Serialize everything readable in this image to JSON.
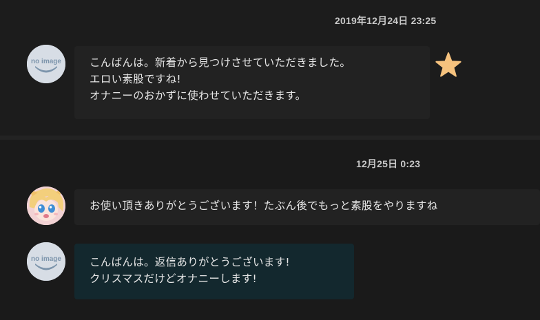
{
  "messages": [
    {
      "timestamp": "2019年12月24日 23:25",
      "avatar": "no-image-avatar",
      "lines": [
        "こんばんは。新着から見つけさせていただきました。",
        "エロい素股ですね!",
        "オナニーのおかずに使わせていただきます。"
      ],
      "icon": "star-icon"
    },
    {
      "timestamp": "12月25日 0:23",
      "avatar": "anime-girl-avatar",
      "lines": [
        "お使い頂きありがとうございます！たぶん後でもっと素股をやりますね"
      ]
    },
    {
      "avatar": "no-image-avatar",
      "lines": [
        "こんばんは。返信ありがとうございます!",
        "クリスマスだけどオナニーします!"
      ]
    }
  ],
  "colors": {
    "star": "#f6c27e",
    "own_bubble": "#13282e",
    "other_bubble": "#222222"
  }
}
